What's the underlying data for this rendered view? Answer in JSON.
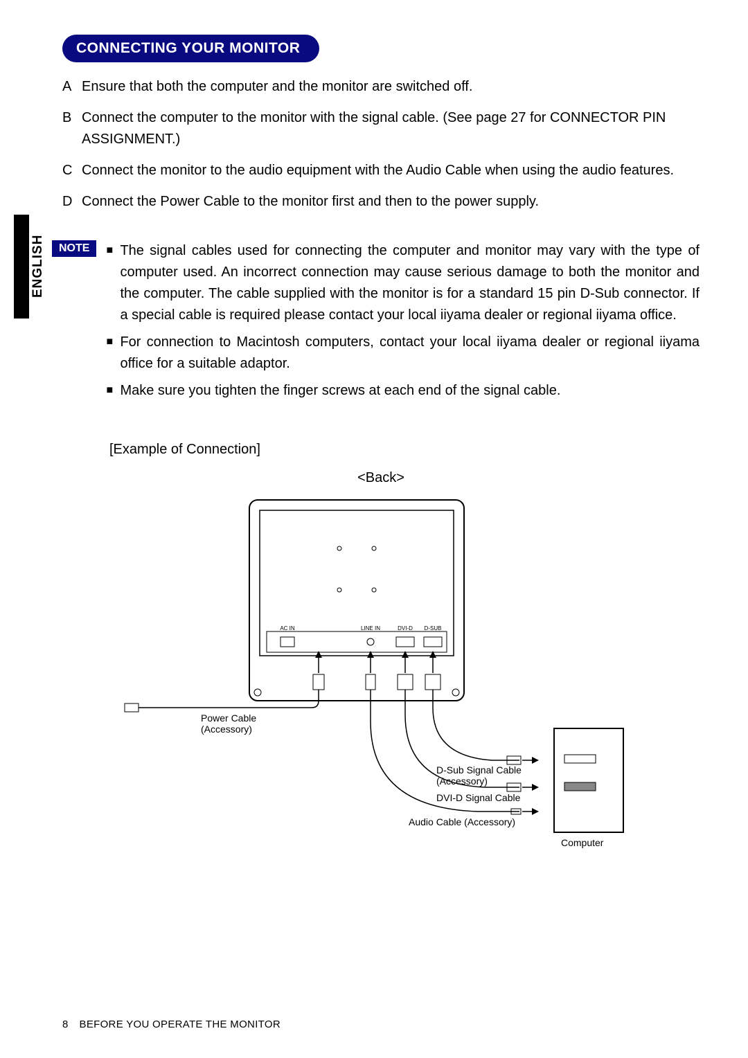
{
  "language_tab": "ENGLISH",
  "section_title": "CONNECTING YOUR MONITOR",
  "steps": {
    "A": {
      "label": "A",
      "text": "Ensure that both the computer and the monitor are switched off."
    },
    "B": {
      "label": "B",
      "text": "Connect the computer to the monitor with the signal cable. (See page 27 for CONNECTOR PIN ASSIGNMENT.)"
    },
    "C": {
      "label": "C",
      "text": "Connect the monitor to the audio equipment with the Audio Cable when using the audio features."
    },
    "D": {
      "label": "D",
      "text": "Connect the Power Cable to the monitor first and then to the power supply."
    }
  },
  "note_label": "NOTE",
  "notes": {
    "n1": "The signal cables used for connecting the computer and monitor may vary with the type of computer used. An incorrect connection may cause serious damage to both the monitor and the computer. The cable supplied with the monitor is for a standard 15 pin D-Sub connector. If a special cable is required please contact your local iiyama dealer or regional iiyama office.",
    "n2": "For connection to Macintosh computers, contact your local iiyama dealer or regional iiyama office for a suitable adaptor.",
    "n3": "Make sure you tighten the finger screws at each end of the signal cable."
  },
  "example_label": "[Example of Connection]",
  "diagram": {
    "back_label": "<Back>",
    "ports": {
      "ac_in": "AC IN",
      "line_in": "LINE IN",
      "dvi_d": "DVI-D",
      "d_sub": "D-SUB"
    },
    "cables": {
      "power": "Power Cable (Accessory)",
      "dsub": "D-Sub Signal Cable (Accessory)",
      "dvid": "DVI-D Signal Cable",
      "audio": "Audio Cable (Accessory)"
    },
    "computer_label": "Computer"
  },
  "footer": {
    "page_number": "8",
    "section": "BEFORE YOU OPERATE THE MONITOR"
  }
}
